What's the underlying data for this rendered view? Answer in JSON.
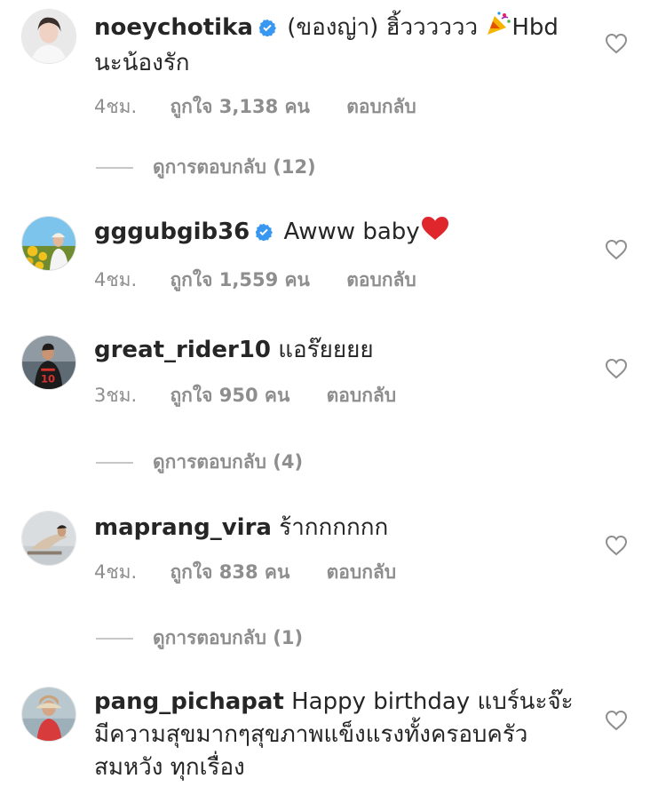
{
  "comments": [
    {
      "username": "noeychotika",
      "verified": true,
      "text": "(ของญ่า) ฮิ้วววววว",
      "emoji": "party-popper",
      "text2": "Hbd นะน้องรัก",
      "time": "4ชม.",
      "likes": "ถูกใจ 3,138 คน",
      "reply": "ตอบกลับ",
      "view_replies": "ดูการตอบกลับ (12)"
    },
    {
      "username": "gggubgib36",
      "verified": true,
      "text": "Awww baby",
      "emoji": "red-heart",
      "time": "4ชม.",
      "likes": "ถูกใจ 1,559 คน",
      "reply": "ตอบกลับ"
    },
    {
      "username": "great_rider10",
      "verified": false,
      "text": "แอร๊ยยยย",
      "time": "3ชม.",
      "likes": "ถูกใจ 950 คน",
      "reply": "ตอบกลับ",
      "view_replies": "ดูการตอบกลับ (4)"
    },
    {
      "username": "maprang_vira",
      "verified": false,
      "text": "ร้ากกกกกก",
      "time": "4ชม.",
      "likes": "ถูกใจ 838 คน",
      "reply": "ตอบกลับ",
      "view_replies": "ดูการตอบกลับ (1)"
    },
    {
      "username": "pang_pichapat",
      "verified": false,
      "text": "Happy birthday แบร์นะจ๊ะ มีความสุขมากๆสุขภาพแข็งแรงทั้งครอบครัว สมหวัง ทุกเรื่อง"
    }
  ],
  "colors": {
    "text": "#262626",
    "meta": "#8e8e8e",
    "verified": "#3897f0",
    "heart_outline": "#8e8e8e"
  }
}
